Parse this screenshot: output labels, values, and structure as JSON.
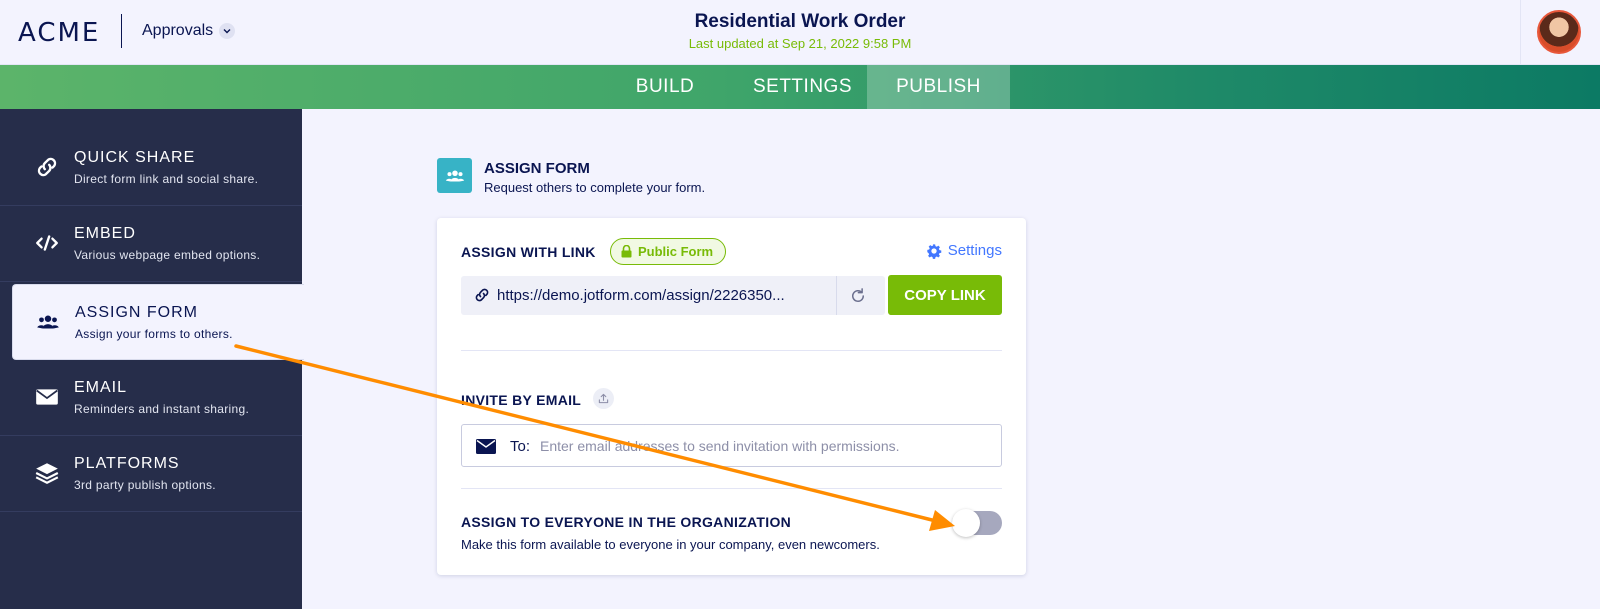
{
  "header": {
    "logo": "ACME",
    "app_switcher": "Approvals",
    "title": "Residential Work Order",
    "last_updated": "Last updated at Sep 21, 2022 9:58 PM"
  },
  "nav": {
    "tabs": [
      {
        "label": "BUILD"
      },
      {
        "label": "SETTINGS"
      },
      {
        "label": "PUBLISH",
        "active": true
      }
    ]
  },
  "sidebar": {
    "items": [
      {
        "label": "QUICK SHARE",
        "desc": "Direct form link and social share.",
        "icon": "link-icon"
      },
      {
        "label": "EMBED",
        "desc": "Various webpage embed options.",
        "icon": "code-icon"
      },
      {
        "label": "ASSIGN FORM",
        "desc": "Assign your forms to others.",
        "icon": "users-icon",
        "active": true
      },
      {
        "label": "EMAIL",
        "desc": "Reminders and instant sharing.",
        "icon": "envelope-icon"
      },
      {
        "label": "PLATFORMS",
        "desc": "3rd party publish options.",
        "icon": "layers-icon"
      }
    ]
  },
  "main": {
    "section_title": "ASSIGN FORM",
    "section_subtitle": "Request others to complete your form.",
    "card": {
      "assign_link_label": "ASSIGN WITH LINK",
      "badge": "Public Form",
      "settings_label": "Settings",
      "link_url": "https://demo.jotform.com/assign/2226350...",
      "copy_button": "COPY LINK",
      "invite_label": "INVITE BY EMAIL",
      "to_label": "To:",
      "email_placeholder": "Enter email addresses to send invitation with permissions.",
      "org_label": "ASSIGN TO EVERYONE IN THE ORGANIZATION",
      "org_desc": "Make this form available to everyone in your company, even newcomers.",
      "org_toggle_on": false
    }
  },
  "colors": {
    "accent_green": "#78bb07",
    "link_blue": "#4277ff",
    "navy": "#0a1551",
    "sidebar_bg": "#262d4a",
    "annotation_arrow": "#ff8c00"
  }
}
